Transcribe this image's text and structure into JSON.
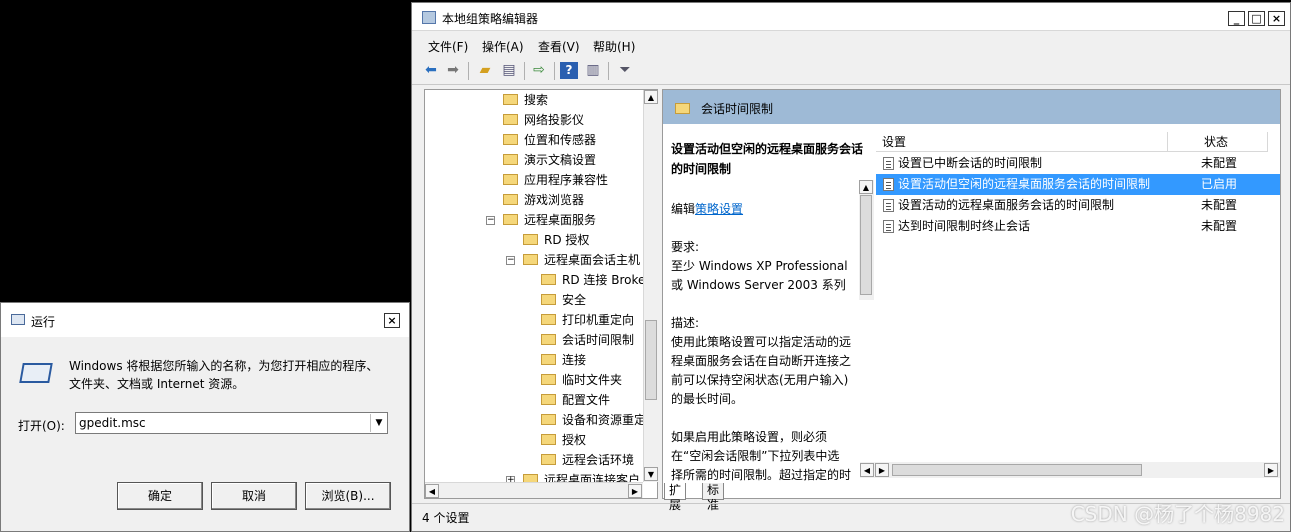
{
  "gpedit": {
    "title": "本地组策略编辑器",
    "window_buttons": {
      "minimize": "_",
      "maximize": "□",
      "close": "×"
    },
    "menu": [
      "文件(F)",
      "操作(A)",
      "查看(V)",
      "帮助(H)"
    ],
    "toolbar_icons": [
      "back-arrow-icon",
      "forward-arrow-icon",
      "up-folder-icon",
      "show-hide-tree-icon",
      "export-list-icon",
      "help-icon",
      "show-hide-action-pane-icon",
      "filter-icon"
    ],
    "tree": [
      {
        "label": "搜索",
        "level": 0
      },
      {
        "label": "网络投影仪",
        "level": 0
      },
      {
        "label": "位置和传感器",
        "level": 0
      },
      {
        "label": "演示文稿设置",
        "level": 0
      },
      {
        "label": "应用程序兼容性",
        "level": 0
      },
      {
        "label": "游戏浏览器",
        "level": 0
      },
      {
        "label": "远程桌面服务",
        "level": 0,
        "expander": "−"
      },
      {
        "label": "RD 授权",
        "level": 1
      },
      {
        "label": "远程桌面会话主机",
        "level": 1,
        "expander": "−"
      },
      {
        "label": "RD 连接 Broke",
        "level": 2
      },
      {
        "label": "安全",
        "level": 2
      },
      {
        "label": "打印机重定向",
        "level": 2
      },
      {
        "label": "会话时间限制",
        "level": 2
      },
      {
        "label": "连接",
        "level": 2
      },
      {
        "label": "临时文件夹",
        "level": 2
      },
      {
        "label": "配置文件",
        "level": 2
      },
      {
        "label": "设备和资源重定",
        "level": 2
      },
      {
        "label": "授权",
        "level": 2
      },
      {
        "label": "远程会话环境",
        "level": 2
      },
      {
        "label": "远程桌面连接客户",
        "level": 1,
        "expander": "+"
      }
    ],
    "middle": {
      "header": "会话时间限制",
      "description": {
        "title_line1": "设置活动但空闲的远程桌面服务会话",
        "title_line2": "的时间限制",
        "edit_prefix": "编辑",
        "edit_link": "策略设置",
        "req_label": "要求:",
        "req_line1": "至少 Windows XP Professional",
        "req_line2": "或 Windows Server 2003 系列",
        "desc_label": "描述:",
        "desc_line1": "使用此策略设置可以指定活动的远",
        "desc_line2": "程桌面服务会话在自动断开连接之",
        "desc_line3": "前可以保持空闲状态(无用户输入)",
        "desc_line4": "的最长时间。",
        "more_line1": "如果启用此策略设置，则必须",
        "more_line2": "在“空闲会话限制”下拉列表中选",
        "more_line3": "择所需的时间限制。超过指定的时"
      },
      "columns": {
        "setting": "设置",
        "state": "状态"
      },
      "rows": [
        {
          "setting": "设置已中断会话的时间限制",
          "state": "未配置",
          "selected": false
        },
        {
          "setting": "设置活动但空闲的远程桌面服务会话的时间限制",
          "state": "已启用",
          "selected": true
        },
        {
          "setting": "设置活动的远程桌面服务会话的时间限制",
          "state": "未配置",
          "selected": false
        },
        {
          "setting": "达到时间限制时终止会话",
          "state": "未配置",
          "selected": false
        }
      ],
      "tabs": [
        "扩展",
        "标准"
      ]
    },
    "status": "4 个设置"
  },
  "run_dialog": {
    "title": "运行",
    "close": "×",
    "prompt_line1": "Windows 将根据您所输入的名称，为您打开相应的程序、",
    "prompt_line2": "文件夹、文档或 Internet 资源。",
    "open_label": "打开(O):",
    "open_value": "gpedit.msc",
    "buttons": {
      "ok": "确定",
      "cancel": "取消",
      "browse": "浏览(B)..."
    }
  },
  "watermark": "CSDN @杨了个杨8982"
}
